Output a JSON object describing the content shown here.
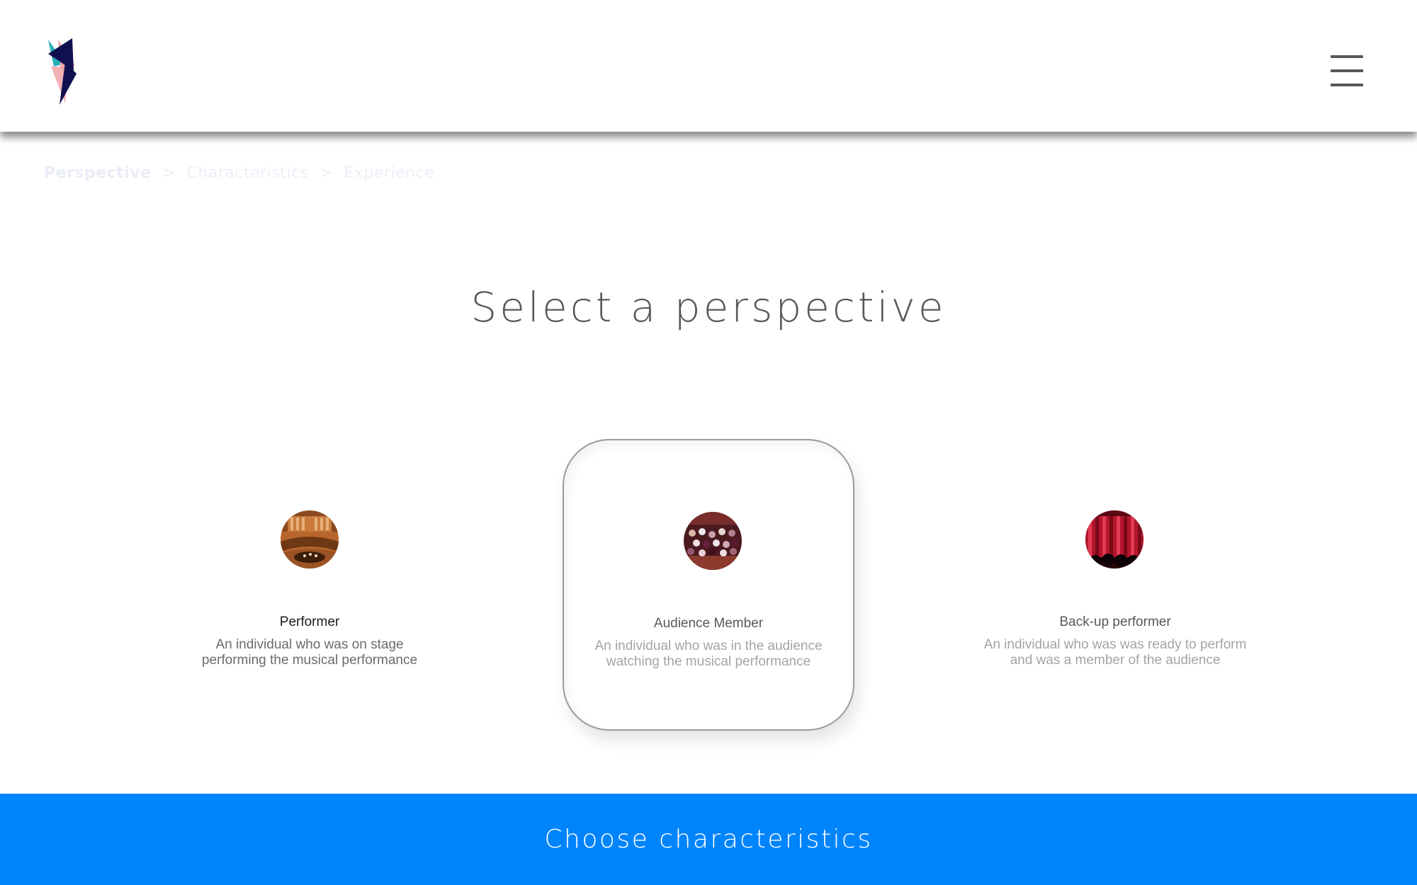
{
  "header": {
    "logo_icon": "abstract-lightning-logo",
    "menu_icon": "hamburger-menu-icon"
  },
  "breadcrumb": {
    "steps": [
      "Perspective",
      "Characteristics",
      "Experience"
    ],
    "separator": ">",
    "active_index": 0
  },
  "main": {
    "title": "Select a perspective",
    "cards": [
      {
        "title": "Performer",
        "description_line1": "An individual who was on stage",
        "description_line2": "performing the musical performance",
        "image": "concert-hall-photo",
        "selected": false
      },
      {
        "title": "Audience Member",
        "description_line1": "An individual who was in the audience",
        "description_line2": "watching the musical performance",
        "image": "audience-crowd-photo",
        "selected": true
      },
      {
        "title": "Back-up performer",
        "description_line1": "An individual who was was ready to perform",
        "description_line2": "and was a member of the audience",
        "image": "red-curtain-photo",
        "selected": false
      }
    ]
  },
  "footer": {
    "cta_label": "Choose characteristics"
  },
  "colors": {
    "accent": "#0084fc",
    "text": "#55595c",
    "muted": "#a4a4a4"
  }
}
